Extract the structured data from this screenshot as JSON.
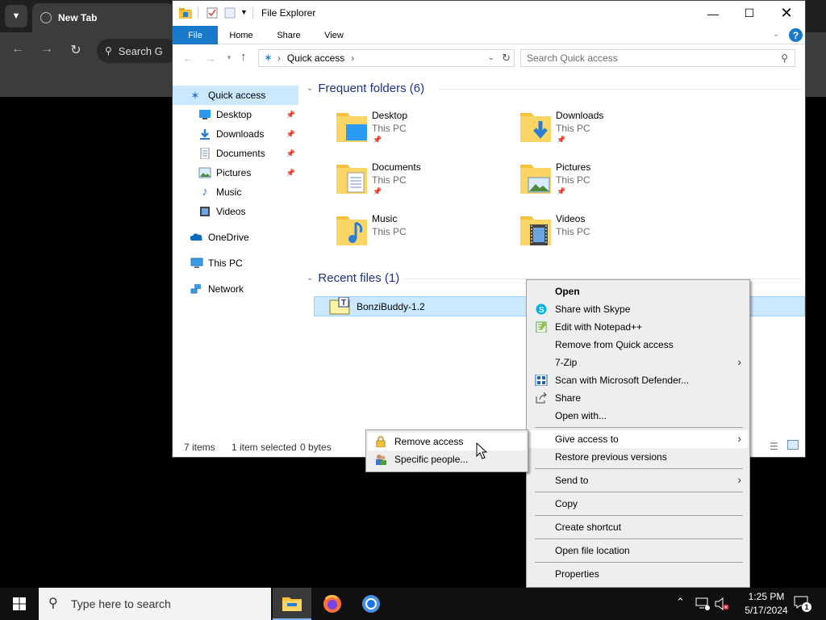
{
  "browser": {
    "tab_title": "New Tab",
    "omnibox_text": "Search G"
  },
  "explorer": {
    "title": "File Explorer",
    "ribbon_tabs": [
      "File",
      "Home",
      "Share",
      "View"
    ],
    "address": "Quick access",
    "search_placeholder": "Search Quick access",
    "nav_items": [
      {
        "label": "Quick access",
        "icon": "star-icon",
        "selected": true
      },
      {
        "label": "Desktop",
        "icon": "desktop-icon",
        "pinned": true
      },
      {
        "label": "Downloads",
        "icon": "downloads-icon",
        "pinned": true
      },
      {
        "label": "Documents",
        "icon": "documents-icon",
        "pinned": true
      },
      {
        "label": "Pictures",
        "icon": "pictures-icon",
        "pinned": true
      },
      {
        "label": "Music",
        "icon": "music-icon"
      },
      {
        "label": "Videos",
        "icon": "videos-icon"
      },
      {
        "label": "OneDrive",
        "icon": "onedrive-icon"
      },
      {
        "label": "This PC",
        "icon": "this-pc-icon"
      },
      {
        "label": "Network",
        "icon": "network-icon"
      }
    ],
    "frequent_header": "Frequent folders (6)",
    "frequent_folders": [
      {
        "name": "Desktop",
        "location": "This PC",
        "pinned": true
      },
      {
        "name": "Downloads",
        "location": "This PC",
        "pinned": true
      },
      {
        "name": "Documents",
        "location": "This PC",
        "pinned": true
      },
      {
        "name": "Pictures",
        "location": "This PC",
        "pinned": true
      },
      {
        "name": "Music",
        "location": "This PC",
        "pinned": false
      },
      {
        "name": "Videos",
        "location": "This PC",
        "pinned": false
      }
    ],
    "recent_header": "Recent files (1)",
    "recent_files": [
      {
        "name": "BonziBuddy-1.2"
      }
    ],
    "status": {
      "items": "7 items",
      "selected": "1 item selected",
      "size": "0 bytes"
    }
  },
  "context_menu": {
    "items": [
      {
        "label": "Open",
        "bold": true
      },
      {
        "label": "Share with Skype",
        "icon": "skype-icon"
      },
      {
        "label": "Edit with Notepad++",
        "icon": "notepadpp-icon"
      },
      {
        "label": "Remove from Quick access"
      },
      {
        "label": "7-Zip",
        "submenu": true
      },
      {
        "label": "Scan with Microsoft Defender...",
        "icon": "defender-icon"
      },
      {
        "label": "Share",
        "icon": "share-icon"
      },
      {
        "label": "Open with..."
      },
      {
        "label": "Give access to",
        "submenu": true,
        "active": true
      },
      {
        "label": "Restore previous versions"
      },
      {
        "label": "Send to",
        "submenu": true
      },
      {
        "label": "Copy"
      },
      {
        "label": "Create shortcut"
      },
      {
        "label": "Open file location"
      },
      {
        "label": "Properties"
      }
    ],
    "submenu_items": [
      {
        "label": "Remove access",
        "icon": "lock-icon",
        "hovered": true
      },
      {
        "label": "Specific people...",
        "icon": "people-icon"
      }
    ]
  },
  "taskbar": {
    "search_placeholder": "Type here to search",
    "clock_time": "1:25 PM",
    "clock_date": "5/17/2024",
    "notification_count": "1"
  },
  "colors": {
    "accent": "#1979ca",
    "selection": "#cce8ff",
    "header_blue": "#1e3287",
    "folder_yellow": "#f5c33b"
  }
}
